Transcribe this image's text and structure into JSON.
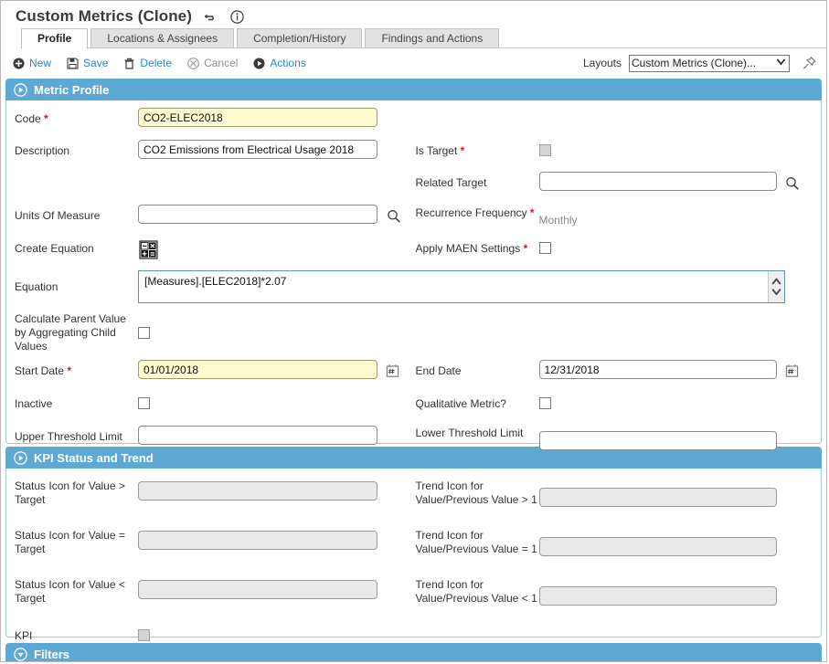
{
  "header": {
    "title": "Custom Metrics (Clone)",
    "icons": [
      {
        "name": "undo-icon"
      },
      {
        "name": "info-icon"
      }
    ]
  },
  "tabs": [
    {
      "label": "Profile",
      "active": true
    },
    {
      "label": "Locations & Assignees",
      "active": false
    },
    {
      "label": "Completion/History",
      "active": false
    },
    {
      "label": "Findings and Actions",
      "active": false
    }
  ],
  "toolbar": {
    "new_label": "New",
    "save_label": "Save",
    "delete_label": "Delete",
    "cancel_label": "Cancel",
    "actions_label": "Actions",
    "layouts_label": "Layouts",
    "layouts_value": "Custom Metrics (Clone)...",
    "pin_icon": "pushpin-icon"
  },
  "colors": {
    "panel_header": "#5da9d4",
    "link": "#2787c8",
    "required_marker": "#d41616",
    "required_field_bg": "#fdfbd0",
    "readonly_field_bg": "#e9e9e9"
  },
  "sections": {
    "metric_profile": {
      "title": "Metric Profile",
      "expanded": true,
      "fields": {
        "code_label": "Code",
        "code_value": "CO2-ELEC2018",
        "description_label": "Description",
        "description_value": "CO2 Emissions from Electrical Usage 2018",
        "units_label": "Units Of Measure",
        "units_value": "",
        "create_equation_label": "Create Equation",
        "equation_label": "Equation",
        "equation_value": "[Measures].[ELEC2018]*2.07",
        "calc_parent_label": "Calculate Parent Value by Aggregating Child Values",
        "start_date_label": "Start Date",
        "start_date_value": "01/01/2018",
        "inactive_label": "Inactive",
        "upper_threshold_label": "Upper Threshold Limit",
        "upper_threshold_value": "",
        "is_target_label": "Is Target",
        "related_target_label": "Related Target",
        "related_target_value": "",
        "recurrence_label": "Recurrence Frequency",
        "recurrence_value": "Monthly",
        "apply_maen_label": "Apply MAEN Settings",
        "end_date_label": "End Date",
        "end_date_value": "12/31/2018",
        "qualitative_label": "Qualitative Metric?",
        "lower_threshold_label": "Lower Threshold Limit",
        "lower_threshold_value": ""
      }
    },
    "kpi_status_trend": {
      "title": "KPI Status and Trend",
      "expanded": true,
      "fields": {
        "status_gt_label": "Status Icon for Value > Target",
        "status_gt_value": "",
        "status_eq_label": "Status Icon for Value = Target",
        "status_eq_value": "",
        "status_lt_label": "Status Icon for Value < Target",
        "status_lt_value": "",
        "kpi_label": "KPI",
        "trend_gt_label": "Trend Icon for Value/Previous Value > 1",
        "trend_gt_value": "",
        "trend_eq_label": "Trend Icon for Value/Previous Value = 1",
        "trend_eq_value": "",
        "trend_lt_label": "Trend Icon for Value/Previous Value < 1",
        "trend_lt_value": ""
      }
    },
    "filters": {
      "title": "Filters",
      "expanded": false
    }
  }
}
